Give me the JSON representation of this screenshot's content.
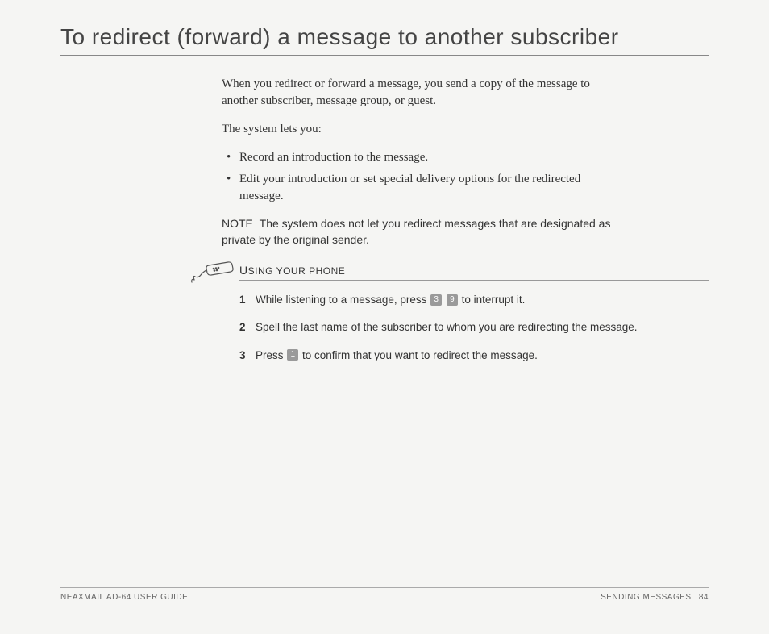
{
  "title": "To redirect (forward) a message to another subscriber",
  "intro": "When you redirect or forward a message, you send a copy of the message to another subscriber, message group, or guest.",
  "lead": "The system lets you:",
  "bullets": [
    "Record an introduction to the message.",
    "Edit your introduction or set special delivery options for the redirected message."
  ],
  "note_label": "NOTE",
  "note_text": "The system does not let you redirect messages that are designated as private by the original sender.",
  "section_heading_cap": "U",
  "section_heading_rest": "SING YOUR PHONE",
  "steps": {
    "s1a": "While listening to a message, press ",
    "s1_key1": "3",
    "s1_key2": "9",
    "s1b": " to interrupt it.",
    "s2": "Spell the last name of the subscriber to whom you are redirecting the message.",
    "s3a": "Press ",
    "s3_key1": "1",
    "s3b": " to confirm that you want to redirect the message."
  },
  "footer": {
    "left": "NEAXMAIL AD-64 USER GUIDE",
    "right_label": "SENDING MESSAGES",
    "page": "84"
  }
}
